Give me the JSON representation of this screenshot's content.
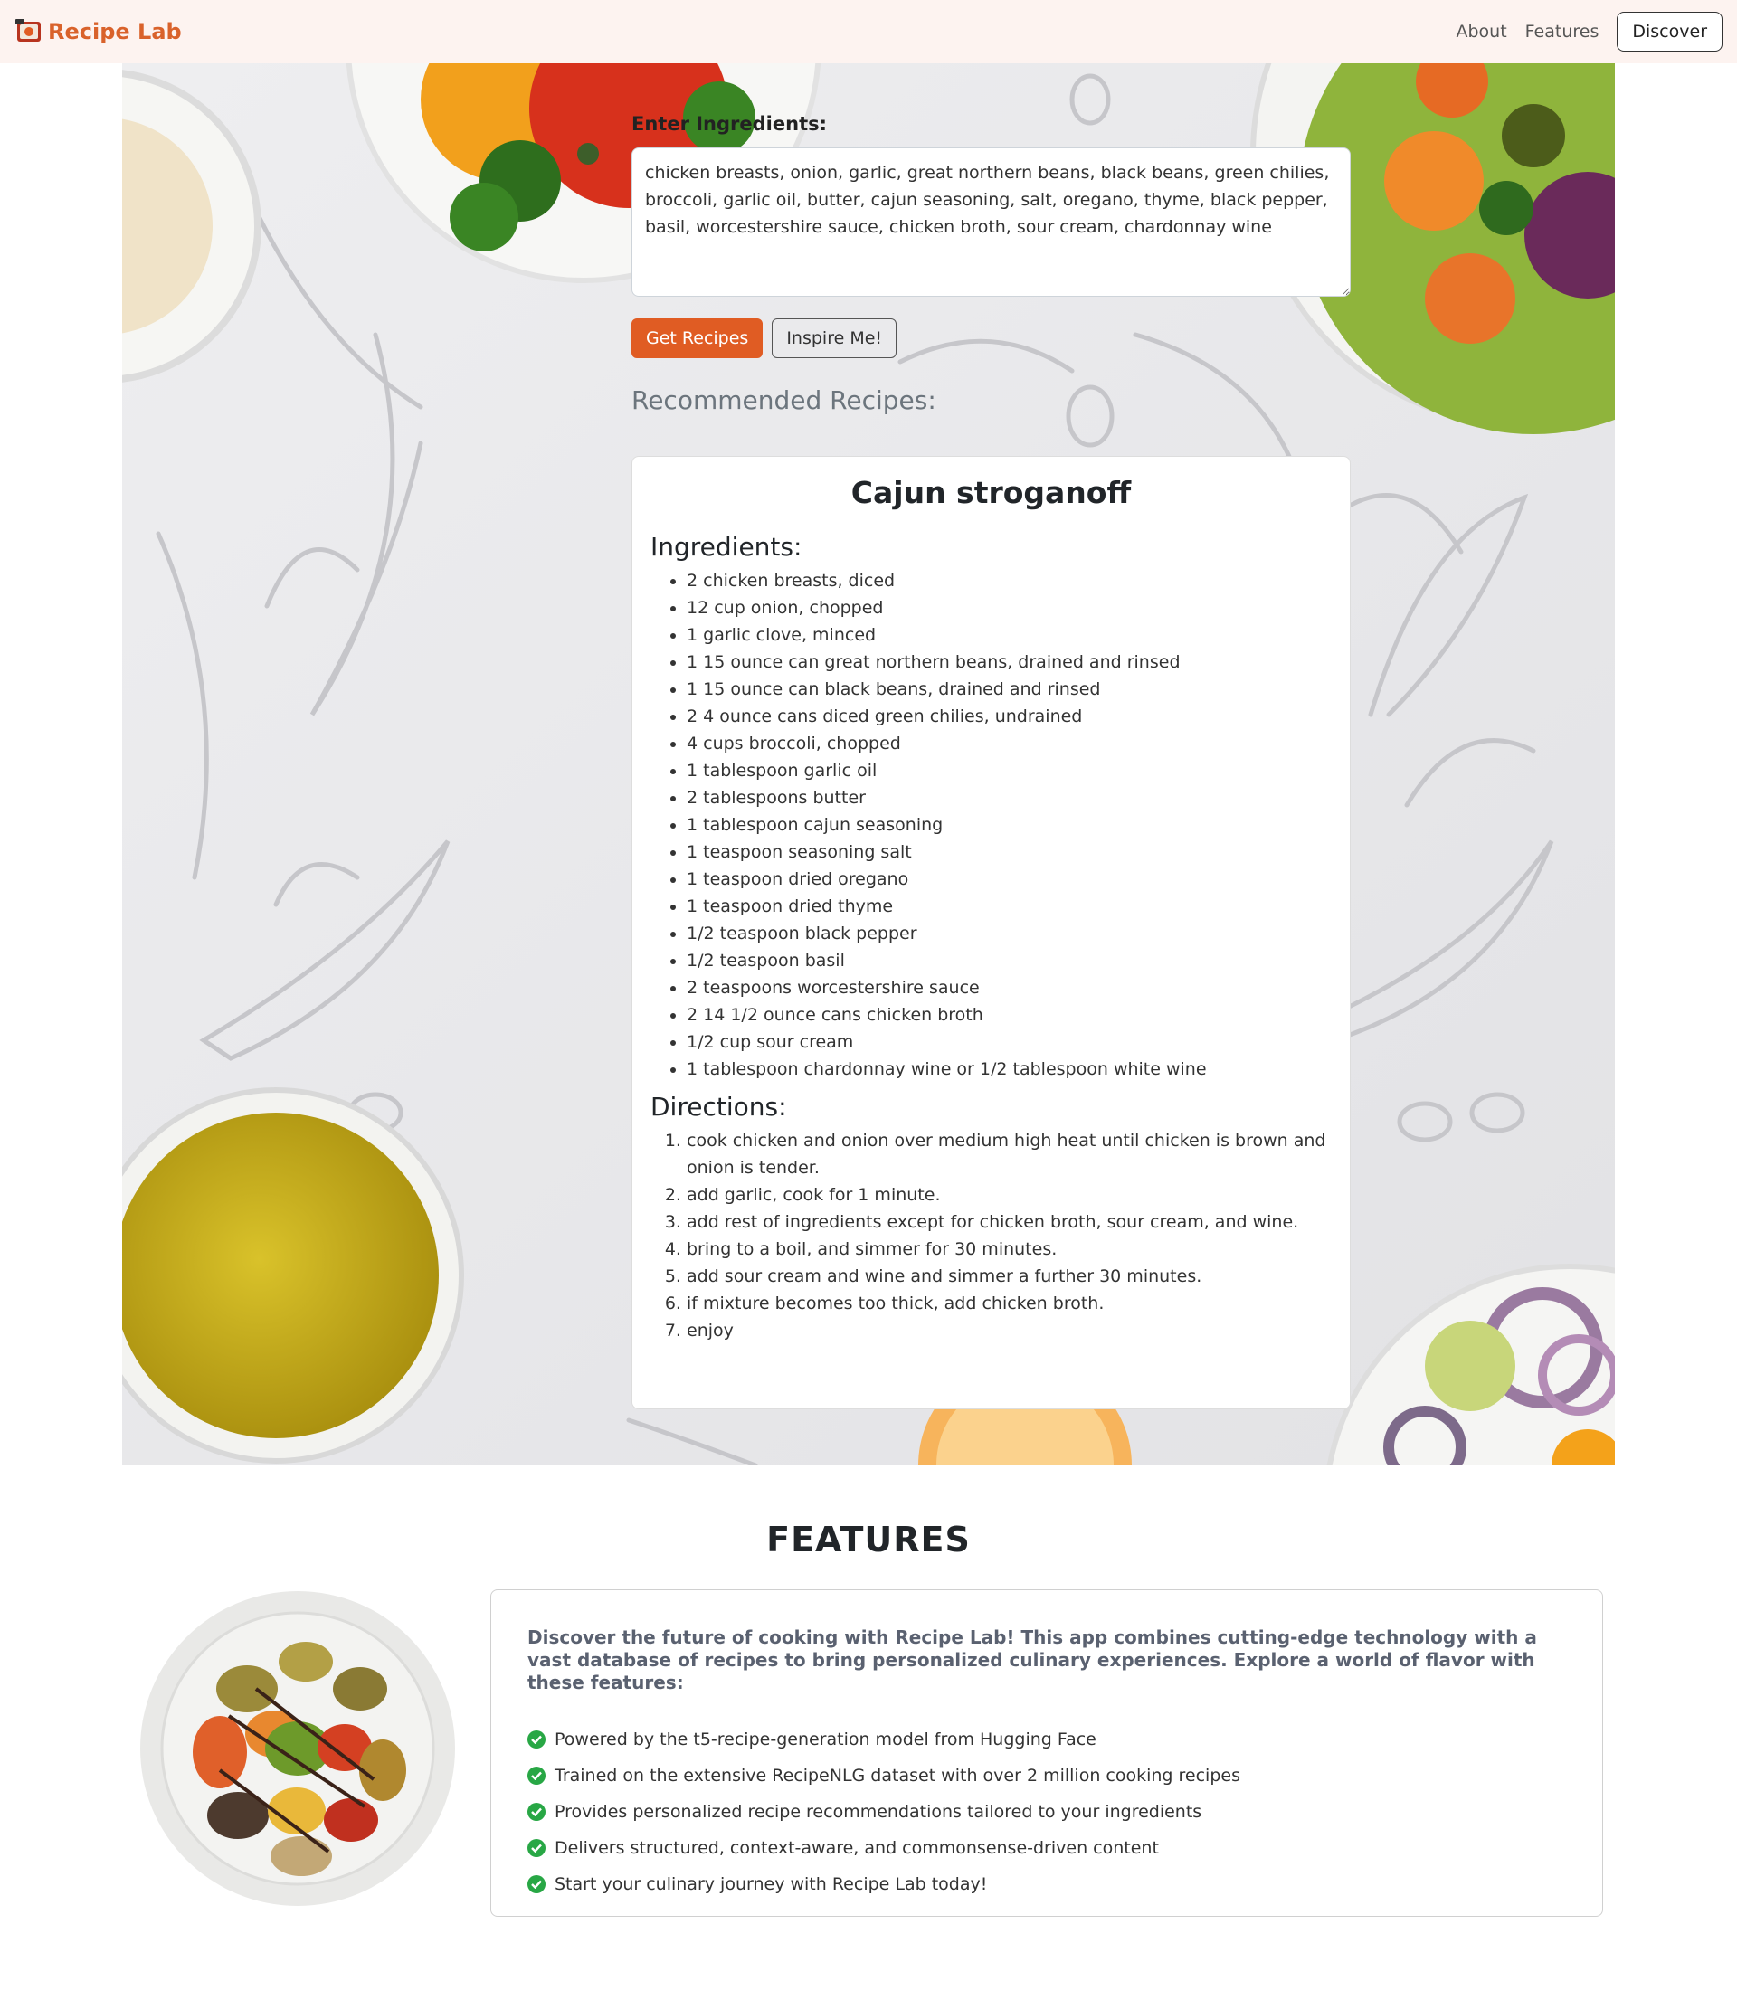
{
  "nav": {
    "brand": "Recipe Lab",
    "links": [
      "About",
      "Features"
    ],
    "discover": "Discover"
  },
  "form": {
    "label": "Enter Ingredients:",
    "ingredients_value": "chicken breasts, onion, garlic, great northern beans, black beans, green chilies, broccoli, garlic oil, butter, cajun seasoning, salt, oregano, thyme, black pepper, basil, worcestershire sauce, chicken broth, sour cream, chardonnay wine",
    "get_recipes": "Get Recipes",
    "inspire_me": "Inspire Me!"
  },
  "recommended_heading": "Recommended Recipes:",
  "recipe": {
    "title": "Cajun stroganoff",
    "ingredients_heading": "Ingredients:",
    "ingredients": [
      "2 chicken breasts, diced",
      "12 cup onion, chopped",
      "1 garlic clove, minced",
      "1 15 ounce can great northern beans, drained and rinsed",
      "1 15 ounce can black beans, drained and rinsed",
      "2 4 ounce cans diced green chilies, undrained",
      "4 cups broccoli, chopped",
      "1 tablespoon garlic oil",
      "2 tablespoons butter",
      "1 tablespoon cajun seasoning",
      "1 teaspoon seasoning salt",
      "1 teaspoon dried oregano",
      "1 teaspoon dried thyme",
      "1/2 teaspoon black pepper",
      "1/2 teaspoon basil",
      "2 teaspoons worcestershire sauce",
      "2 14 1/2 ounce cans chicken broth",
      "1/2 cup sour cream",
      "1 tablespoon chardonnay wine or 1/2 tablespoon white wine"
    ],
    "directions_heading": "Directions:",
    "directions": [
      "cook chicken and onion over medium high heat until chicken is brown and onion is tender.",
      "add garlic, cook for 1 minute.",
      "add rest of ingredients except for chicken broth, sour cream, and wine.",
      "bring to a boil, and simmer for 30 minutes.",
      "add sour cream and wine and simmer a further 30 minutes.",
      "if mixture becomes too thick, add chicken broth.",
      "enjoy"
    ]
  },
  "features": {
    "title": "FEATURES",
    "intro": "Discover the future of cooking with Recipe Lab! This app combines cutting-edge technology with a vast database of recipes to bring personalized culinary experiences. Explore a world of flavor with these features:",
    "items": [
      "Powered by the t5-recipe-generation model from Hugging Face",
      "Trained on the extensive RecipeNLG dataset with over 2 million cooking recipes",
      "Provides personalized recipe recommendations tailored to your ingredients",
      "Delivers structured, context-aware, and commonsense-driven content",
      "Start your culinary journey with Recipe Lab today!"
    ]
  },
  "colors": {
    "brand": "#d9622b",
    "primary_button": "#e05c23",
    "check": "#28a745",
    "navbar_bg": "#fdf3f0"
  },
  "icons": [
    "recipe-book-logo-icon",
    "check-circle-icon"
  ]
}
